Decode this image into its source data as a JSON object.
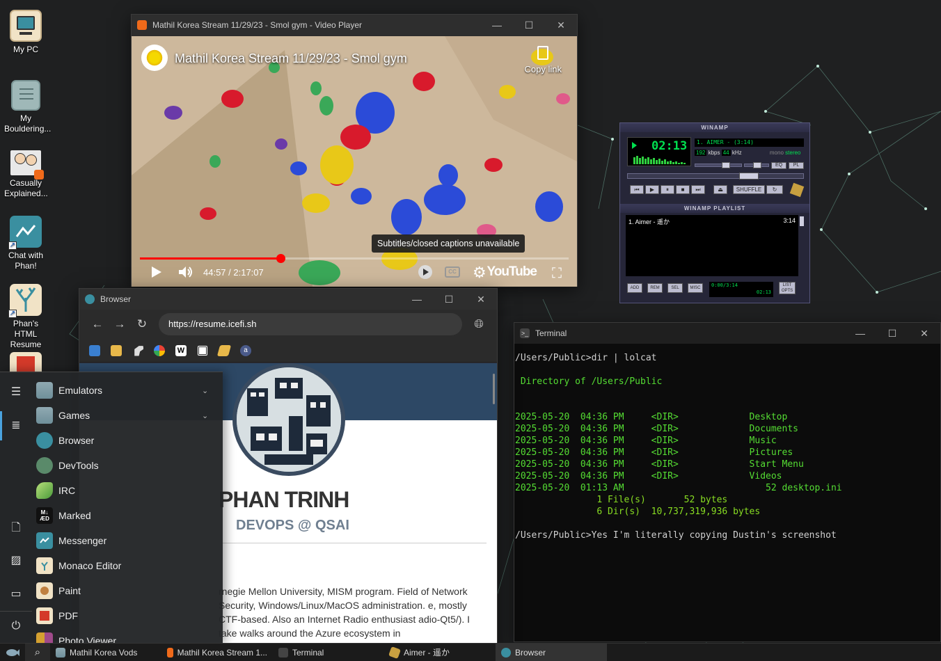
{
  "desktop": {
    "icons": [
      {
        "label": "My PC",
        "icon": "monitor-icon"
      },
      {
        "label": "My Bouldering...",
        "icon": "notepad-icon"
      },
      {
        "label": "Casually Explained...",
        "icon": "video-thumbnail-icon"
      },
      {
        "label": "Chat with Phan!",
        "icon": "messenger-icon"
      },
      {
        "label": "Phan's HTML Resume",
        "icon": "coral-icon"
      },
      {
        "label": "",
        "icon": "pdf-icon"
      }
    ]
  },
  "video_player": {
    "window_title": "Mathil Korea Stream 11/29/23 - Smol gym - Video Player",
    "video_title": "Mathil Korea Stream 11/29/23 - Smol gym",
    "copy_link": "Copy link",
    "caption_tooltip": "Subtitles/closed captions unavailable",
    "time": "44:57 / 2:17:07",
    "progress_fraction": 0.328,
    "youtube_logo": "YouTube",
    "cc_label": "CC"
  },
  "browser": {
    "window_title": "Browser",
    "url": "https://resume.icefi.sh",
    "bookmarks": [
      "folder-bookmark-icon",
      "folder-bookmark-icon",
      "dino-bookmark-icon",
      "google-bookmark-icon",
      "wikipedia-bookmark-icon",
      "archive-bookmark-icon",
      "lightning-bookmark-icon",
      "a-bookmark-icon"
    ],
    "resume": {
      "name": "PHAN TRINH",
      "role": "DEVOPS @ QSAI",
      "text": "rnegie Mellon University, MISM program. Field of Network Security, Windows/Linux/MacOS administration. e, mostly CTF-based. Also an Internet Radio enthusiast adio-Qt5/). I take walks around the Azure ecosystem in"
    }
  },
  "start_menu": {
    "items": [
      {
        "label": "Emulators",
        "icon": "folder-icon",
        "expandable": true
      },
      {
        "label": "Games",
        "icon": "folder-icon",
        "expandable": true
      },
      {
        "label": "Browser",
        "icon": "browser-icon",
        "expandable": false
      },
      {
        "label": "DevTools",
        "icon": "devtools-icon",
        "expandable": false
      },
      {
        "label": "IRC",
        "icon": "irc-icon",
        "expandable": false
      },
      {
        "label": "Marked",
        "icon": "marked-icon",
        "expandable": false
      },
      {
        "label": "Messenger",
        "icon": "messenger-icon",
        "expandable": false
      },
      {
        "label": "Monaco Editor",
        "icon": "monaco-icon",
        "expandable": false
      },
      {
        "label": "Paint",
        "icon": "paint-icon",
        "expandable": false
      },
      {
        "label": "PDF",
        "icon": "pdf-icon",
        "expandable": false
      },
      {
        "label": "Photo Viewer",
        "icon": "photo-icon",
        "expandable": false
      }
    ],
    "marked_badge": "M↓ ÆD"
  },
  "winamp": {
    "title": "WINAMP",
    "clock": "02:13",
    "marquee": "1. AIMER - (3:14)",
    "kbps": "192",
    "khz": "44",
    "kbps_label": "kbps",
    "khz_label": "kHz",
    "mono": "mono",
    "stereo": "stereo",
    "eq": "EQ",
    "pl": "PL",
    "shuffle": "SHUFFLE",
    "playlist_title": "WINAMP PLAYLIST",
    "track": "1. Aimer - 遥か",
    "track_time": "3:14",
    "pl_buttons": [
      "ADD",
      "REM",
      "SEL",
      "MISC"
    ],
    "list_opts": "LIST OPTS",
    "pl_time": "0:00/3:14",
    "pl_elapsed": "02:13"
  },
  "terminal": {
    "window_title": "Terminal",
    "prompt1": "/Users/Public>dir | lolcat",
    "directory_line": " Directory of /Users/Public",
    "entries": [
      {
        "date": "2025-05-20",
        "time": "04:36 PM",
        "type": "<DIR>",
        "size": "",
        "name": "Desktop"
      },
      {
        "date": "2025-05-20",
        "time": "04:36 PM",
        "type": "<DIR>",
        "size": "",
        "name": "Documents"
      },
      {
        "date": "2025-05-20",
        "time": "04:36 PM",
        "type": "<DIR>",
        "size": "",
        "name": "Music"
      },
      {
        "date": "2025-05-20",
        "time": "04:36 PM",
        "type": "<DIR>",
        "size": "",
        "name": "Pictures"
      },
      {
        "date": "2025-05-20",
        "time": "04:36 PM",
        "type": "<DIR>",
        "size": "",
        "name": "Start Menu"
      },
      {
        "date": "2025-05-20",
        "time": "04:36 PM",
        "type": "<DIR>",
        "size": "",
        "name": "Videos"
      },
      {
        "date": "2025-05-20",
        "time": "01:13 AM",
        "type": "",
        "size": "52",
        "name": "desktop.ini"
      }
    ],
    "summary1": "               1 File(s)       52 bytes",
    "summary2": "               6 Dir(s)  10,737,319,936 bytes",
    "prompt2": "/Users/Public>Yes I'm literally copying Dustin's screenshot"
  },
  "taskbar": {
    "items": [
      {
        "label": "Mathil Korea Vods",
        "icon": "folder-icon"
      },
      {
        "label": "Mathil Korea Stream 1...",
        "icon": "video-player-icon"
      },
      {
        "label": "Terminal",
        "icon": "terminal-icon"
      },
      {
        "label": "Aimer - 遥か",
        "icon": "winamp-icon"
      },
      {
        "label": "Browser",
        "icon": "browser-icon"
      }
    ]
  },
  "colors": {
    "accent": "#4aa3df",
    "terminal_green": "#55dd33",
    "winamp_green": "#00e050"
  }
}
